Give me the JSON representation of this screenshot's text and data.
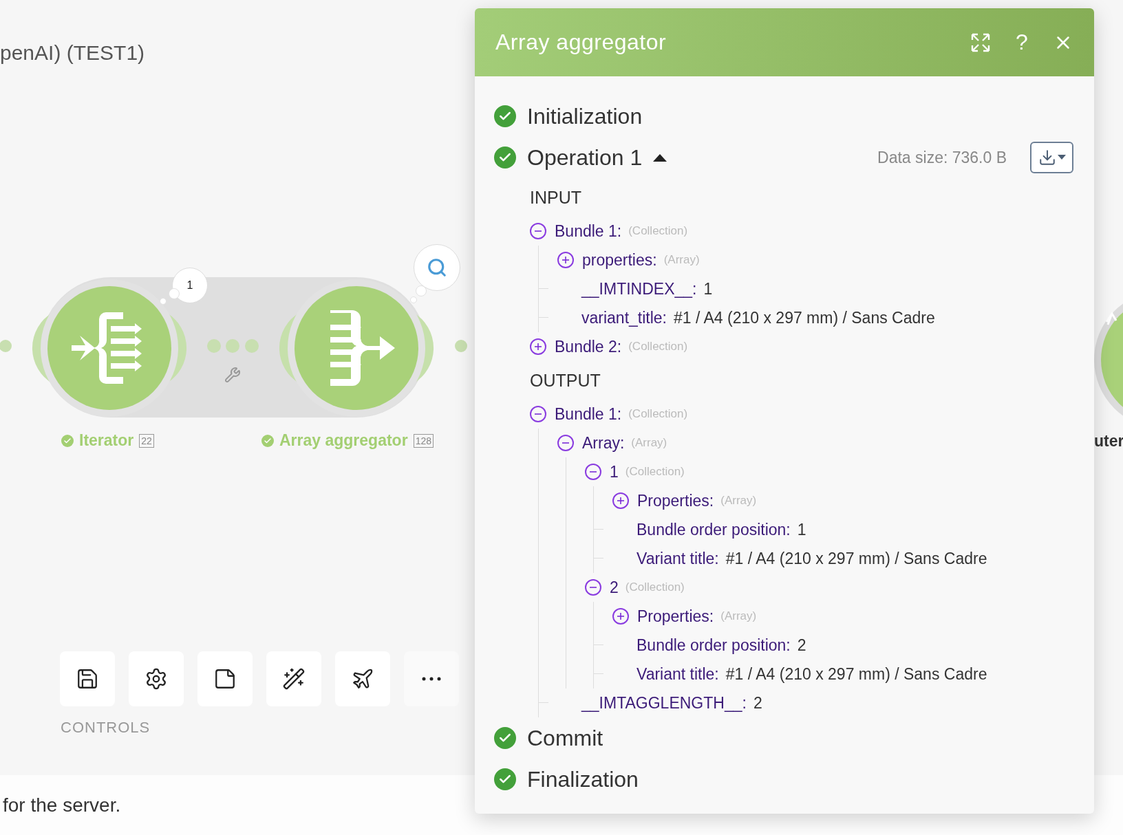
{
  "canvas": {
    "scenario_title": "penAI) (TEST1)",
    "modules": [
      {
        "kind": "iterator",
        "name": "Iterator",
        "count": "22",
        "success": true,
        "bubble": {
          "kind": "count",
          "text": "1"
        }
      },
      {
        "kind": "aggregator",
        "name": "Array aggregator",
        "count": "128",
        "success": true,
        "bubble": {
          "kind": "search"
        }
      }
    ],
    "partial_module_label": "uter"
  },
  "toolbar": {
    "buttons": [
      {
        "kind": "save"
      },
      {
        "kind": "settings"
      },
      {
        "kind": "notes"
      },
      {
        "kind": "magic"
      },
      {
        "kind": "airplane"
      },
      {
        "kind": "more"
      }
    ],
    "label": "CONTROLS"
  },
  "footer_text": "for the server.",
  "panel": {
    "title": "Array aggregator",
    "help_label": "?",
    "phases": [
      {
        "label": "Initialization",
        "success": true
      },
      {
        "label": "Operation 1",
        "success": true,
        "expanded": true,
        "data_size": "Data size: 736.0 B",
        "sections": [
          {
            "label": "INPUT",
            "tree": [
              {
                "key": "Bundle 1:",
                "type": "(Collection)",
                "expanded": true,
                "children": [
                  {
                    "key": "properties:",
                    "type": "(Array)",
                    "expanded": false
                  },
                  {
                    "key": "__IMTINDEX__:",
                    "value": "1"
                  },
                  {
                    "key": "variant_title:",
                    "value": "#1 / A4 (210 x 297 mm) / Sans Cadre"
                  }
                ]
              },
              {
                "key": "Bundle 2:",
                "type": "(Collection)",
                "expanded": false
              }
            ]
          },
          {
            "label": "OUTPUT",
            "tree": [
              {
                "key": "Bundle 1:",
                "type": "(Collection)",
                "expanded": true,
                "children": [
                  {
                    "key": "Array:",
                    "type": "(Array)",
                    "expanded": true,
                    "children": [
                      {
                        "key": "1",
                        "type": "(Collection)",
                        "expanded": true,
                        "children": [
                          {
                            "key": "Properties:",
                            "type": "(Array)",
                            "expanded": false
                          },
                          {
                            "key": "Bundle order position:",
                            "value": "1"
                          },
                          {
                            "key": "Variant title:",
                            "value": "#1 / A4 (210 x 297 mm) / Sans Cadre"
                          }
                        ]
                      },
                      {
                        "key": "2",
                        "type": "(Collection)",
                        "expanded": true,
                        "children": [
                          {
                            "key": "Properties:",
                            "type": "(Array)",
                            "expanded": false
                          },
                          {
                            "key": "Bundle order position:",
                            "value": "2"
                          },
                          {
                            "key": "Variant title:",
                            "value": "#1 / A4 (210 x 297 mm) / Sans Cadre"
                          }
                        ]
                      }
                    ]
                  },
                  {
                    "key": "__IMTAGGLENGTH__:",
                    "value": "2"
                  }
                ]
              }
            ]
          }
        ]
      },
      {
        "label": "Commit",
        "success": true
      },
      {
        "label": "Finalization",
        "success": true
      }
    ]
  }
}
